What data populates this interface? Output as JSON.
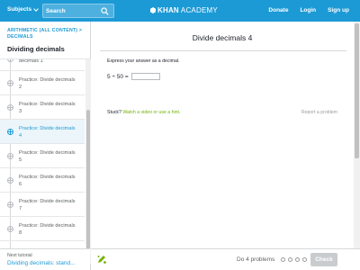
{
  "header": {
    "subjects_label": "Subjects",
    "search_placeholder": "Search",
    "logo_khan": "KHAN",
    "logo_academy": "ACADEMY",
    "donate_label": "Donate",
    "login_label": "Login",
    "signup_label": "Sign up",
    "accent_color": "#1c9ad6"
  },
  "sidebar": {
    "breadcrumb": "ARITHMETIC (ALL CONTENT) > DECIMALS",
    "title": "Dividing decimals",
    "items": [
      {
        "label": "decimals 1"
      },
      {
        "label": "Practice: Divide decimals 2"
      },
      {
        "label": "Practice: Divide decimals 3"
      },
      {
        "label": "Practice: Divide decimals 4"
      },
      {
        "label": "Practice: Divide decimals 5"
      },
      {
        "label": "Practice: Divide decimals 6"
      },
      {
        "label": "Practice: Divide decimals 7"
      },
      {
        "label": "Practice: Divide decimals 8"
      }
    ],
    "active_index": 3,
    "next_label": "Next tutorial",
    "next_link": "Dividing decimals: stand..."
  },
  "exercise": {
    "title": "Divide decimals 4",
    "instruction": "Express your answer as a decimal.",
    "problem": "5 ÷ 50 =",
    "answer_value": "",
    "stuck_label": "Stuck?",
    "stuck_link": "Watch a video or use a hint.",
    "report_label": "Report a problem"
  },
  "footer": {
    "progress_text": "Do 4 problems",
    "dot_count": 4,
    "check_label": "Check"
  }
}
